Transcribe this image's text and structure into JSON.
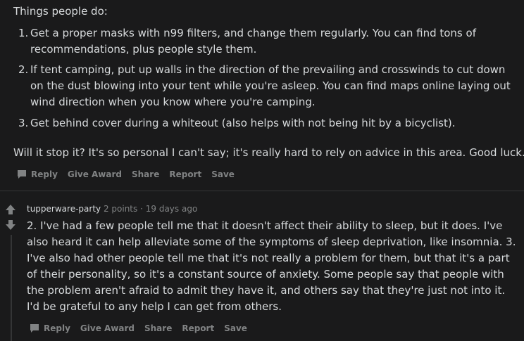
{
  "parent": {
    "intro": "Things people do:",
    "list": [
      {
        "num": "1.",
        "text": "Get a proper masks with n99 filters, and change them regularly. You can find tons of recommendations, plus people style them."
      },
      {
        "num": "2.",
        "text": "If tent camping, put up walls in the direction of the prevailing and crosswinds to cut down on the dust blowing into your tent while you're asleep. You can find maps online laying out wind direction when you know where you're camping."
      },
      {
        "num": "3.",
        "text": "Get behind cover during a whiteout (also helps with not being hit by a bicyclist)."
      }
    ],
    "closing": "Will it stop it? It's so personal I can't say; it's really hard to rely on advice in this area. Good luck.",
    "actions": {
      "reply": "Reply",
      "give_award": "Give Award",
      "share": "Share",
      "report": "Report",
      "save": "Save"
    }
  },
  "reply": {
    "username": "tupperware-party",
    "points": "2 points",
    "separator": "·",
    "age": "19 days ago",
    "body": "2. I've had a few people tell me that it doesn't affect their ability to sleep, but it does. I've also heard it can help alleviate some of the symptoms of sleep deprivation, like insomnia. 3. I've also had other people tell me that it's not really a problem for them, but that it's a part of their personality, so it's a constant source of anxiety. Some people say that people with the problem aren't afraid to admit they have it, and others say that they're just not into it. I'd be grateful to any help I can get from others.",
    "actions": {
      "reply": "Reply",
      "give_award": "Give Award",
      "share": "Share",
      "report": "Report",
      "save": "Save"
    }
  },
  "colors": {
    "background": "#1a1a1b",
    "text": "#d7dadc",
    "muted": "#818384",
    "divider": "#343536"
  }
}
